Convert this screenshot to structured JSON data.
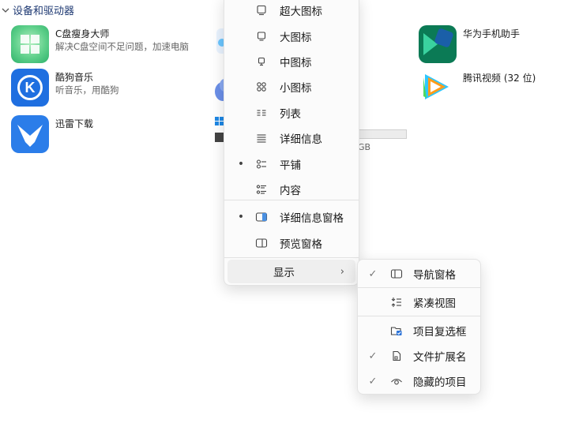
{
  "section": {
    "title": "设备和驱动器"
  },
  "apps": [
    {
      "name": "C盘瘦身大师",
      "desc": "解决C盘空间不足问题，加速电脑"
    },
    {
      "name": "酷狗音乐",
      "desc": "听音乐，用酷狗"
    },
    {
      "name": "迅雷下载",
      "desc": ""
    },
    {
      "name": "华为手机助手",
      "desc": ""
    },
    {
      "name": "腾讯视频 (32 位)",
      "desc": ""
    }
  ],
  "drive": {
    "size_suffix": "GB"
  },
  "view_menu": {
    "items": [
      {
        "label": "超大图标",
        "icon": "monitor-icon",
        "selected": false
      },
      {
        "label": "大图标",
        "icon": "monitor-icon",
        "selected": false
      },
      {
        "label": "中图标",
        "icon": "small-monitor-icon",
        "selected": false
      },
      {
        "label": "小图标",
        "icon": "grid-icon",
        "selected": false
      },
      {
        "label": "列表",
        "icon": "list-icon",
        "selected": false
      },
      {
        "label": "详细信息",
        "icon": "details-icon",
        "selected": false
      },
      {
        "label": "平铺",
        "icon": "tiles-icon",
        "selected": true
      },
      {
        "label": "内容",
        "icon": "content-icon",
        "selected": false
      },
      {
        "label": "详细信息窗格",
        "icon": "details-pane-icon",
        "selected": true
      },
      {
        "label": "预览窗格",
        "icon": "preview-pane-icon",
        "selected": false
      }
    ],
    "show_label": "显示"
  },
  "show_submenu": {
    "items": [
      {
        "label": "导航窗格",
        "icon": "navigation-pane-icon",
        "checked": true
      },
      {
        "label": "紧凑视图",
        "icon": "compact-view-icon",
        "checked": false
      },
      {
        "label": "项目复选框",
        "icon": "item-checkbox-icon",
        "checked": false
      },
      {
        "label": "文件扩展名",
        "icon": "file-extension-icon",
        "checked": true
      },
      {
        "label": "隐藏的项目",
        "icon": "hidden-items-icon",
        "checked": true
      }
    ]
  },
  "glyphs": {
    "bullet": "•",
    "check": "✓",
    "chevron_right": "›",
    "chevron_down": "⌵"
  }
}
